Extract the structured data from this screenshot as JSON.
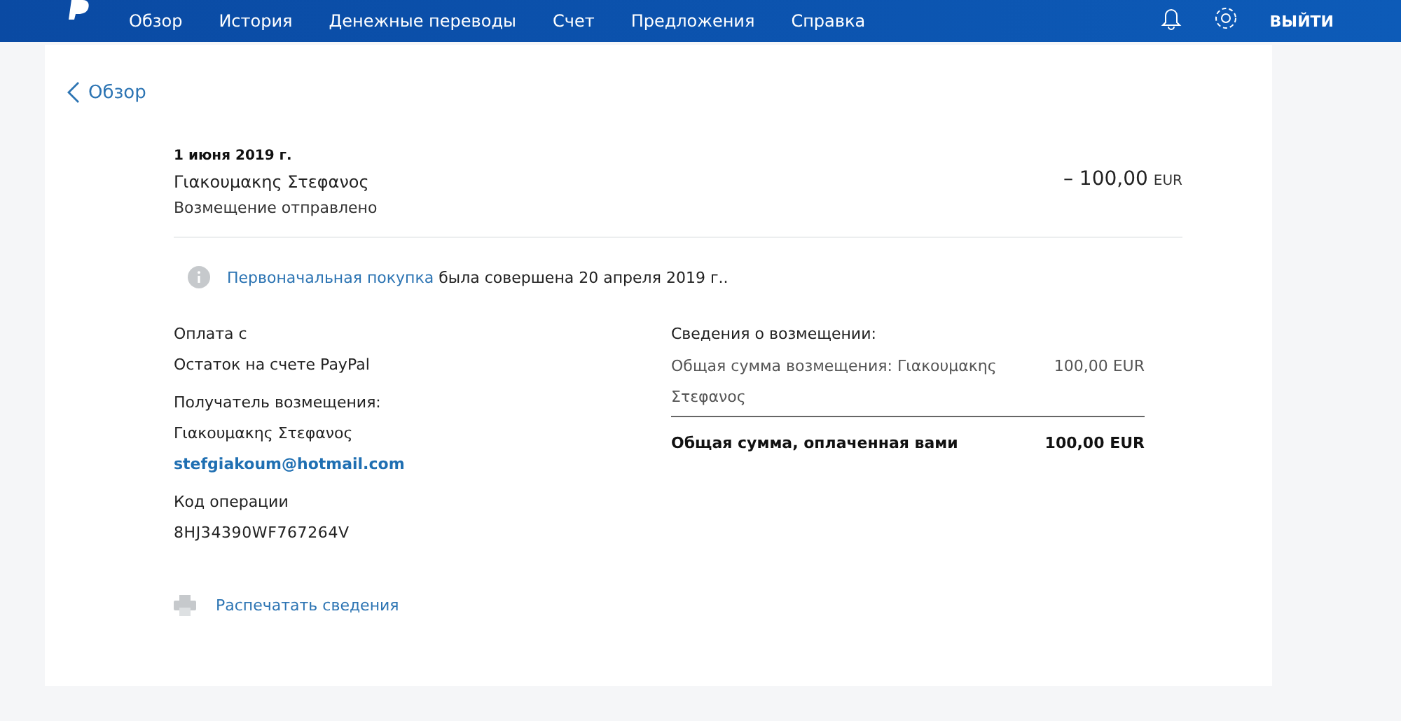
{
  "nav": {
    "items": [
      {
        "label": "Обзор"
      },
      {
        "label": "История"
      },
      {
        "label": "Денежные переводы"
      },
      {
        "label": "Счет"
      },
      {
        "label": "Предложения"
      },
      {
        "label": "Справка"
      }
    ],
    "logout": "ВЫЙТИ"
  },
  "back": "Обзор",
  "transaction": {
    "date": "1 июня 2019 г.",
    "name": "Γιακουμακης Στεφανος",
    "status": "Возмещение отправлено",
    "amount": "– 100,00",
    "currency": "EUR"
  },
  "notice": {
    "link": "Первоначальная покупка",
    "text": " была совершена 20 апреля 2019 г.."
  },
  "left": [
    {
      "label": "Оплата с",
      "lines": [
        {
          "text": "Остаток на счете PayPal",
          "kind": "text"
        }
      ]
    },
    {
      "label": "Получатель возмещения:",
      "lines": [
        {
          "text": "Γιακουμακης Στεφανος",
          "kind": "text"
        },
        {
          "text": "stefgiakoum@hotmail.com",
          "kind": "email"
        }
      ]
    },
    {
      "label": "Код операции",
      "lines": [
        {
          "text": "8HJ34390WF767264V",
          "kind": "code"
        }
      ]
    }
  ],
  "refund": {
    "title": "Сведения о возмещении:",
    "rows": [
      {
        "label": "Общая сумма возмещения: Γιακουμακης Στεφανος",
        "value": "100,00 EUR"
      }
    ],
    "total": {
      "label": "Общая сумма, оплаченная вами",
      "value": "100,00 EUR"
    }
  },
  "print": "Распечатать сведения"
}
